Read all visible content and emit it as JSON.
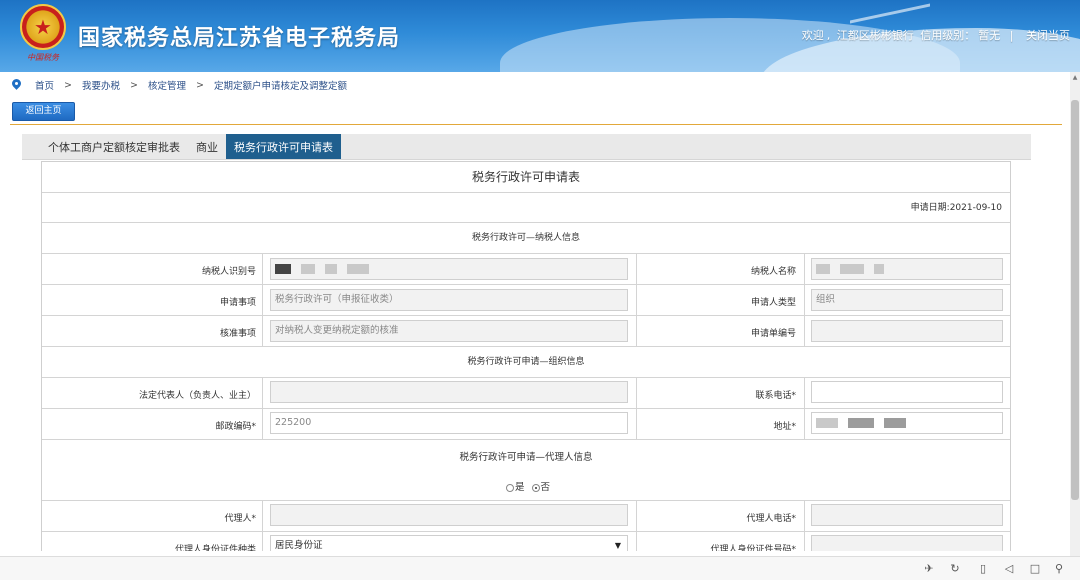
{
  "header": {
    "emblem_text": "中国税务",
    "site_title": "国家税务总局江苏省电子税务局",
    "welcome": "欢迎",
    "user_name": "江都区彬彬银行",
    "credit_label": "信用级别：",
    "credit_value": "暂无",
    "close_label": "关闭当页"
  },
  "breadcrumb": {
    "items": [
      "首页",
      "我要办税",
      "核定管理",
      "定期定额户申请核定及调整定额"
    ],
    "separator": ">"
  },
  "back_button": "返回主页",
  "tabs": [
    {
      "label": "个体工商户定额核定审批表",
      "active": false
    },
    {
      "label": "商业",
      "active": false
    },
    {
      "label": "税务行政许可申请表",
      "active": true
    }
  ],
  "form": {
    "title": "税务行政许可申请表",
    "date_label": "申请日期:",
    "date_value": "2021-09-10",
    "section_taxpayer": "税务行政许可—纳税人信息",
    "section_org": "税务行政许可申请—组织信息",
    "section_agent": "税务行政许可申请—代理人信息",
    "fields": {
      "taxpayer_id_label": "纳税人识别号",
      "taxpayer_name_label": "纳税人名称",
      "apply_item_label": "申请事项",
      "apply_item_value": "税务行政许可（申报征收类）",
      "applicant_type_label": "申请人类型",
      "applicant_type_value": "组织",
      "approve_item_label": "核准事项",
      "approve_item_value": "对纳税人变更纳税定额的核准",
      "apply_no_label": "申请单编号",
      "legal_rep_label": "法定代表人（负责人、业主）",
      "phone_label": "联系电话*",
      "postcode_label": "邮政编码*",
      "postcode_value": "225200",
      "address_label": "地址*",
      "agent_label": "代理人*",
      "agent_phone_label": "代理人电话*",
      "agent_id_type_label": "代理人身份证件种类",
      "agent_id_type_value": "居民身份证",
      "agent_id_no_label": "代理人身份证件号码*"
    },
    "radio": {
      "yes_label": "是",
      "no_label": "否",
      "selected": "否"
    }
  },
  "colors": {
    "banner_blue": "#2f8bd8",
    "active_tab": "#1f5f8e",
    "gold_line": "#e2a83a"
  },
  "toolbar_icons": [
    "pin-icon",
    "share-icon",
    "delete-icon",
    "volume-icon",
    "window-icon",
    "copy-icon",
    "search-icon"
  ]
}
